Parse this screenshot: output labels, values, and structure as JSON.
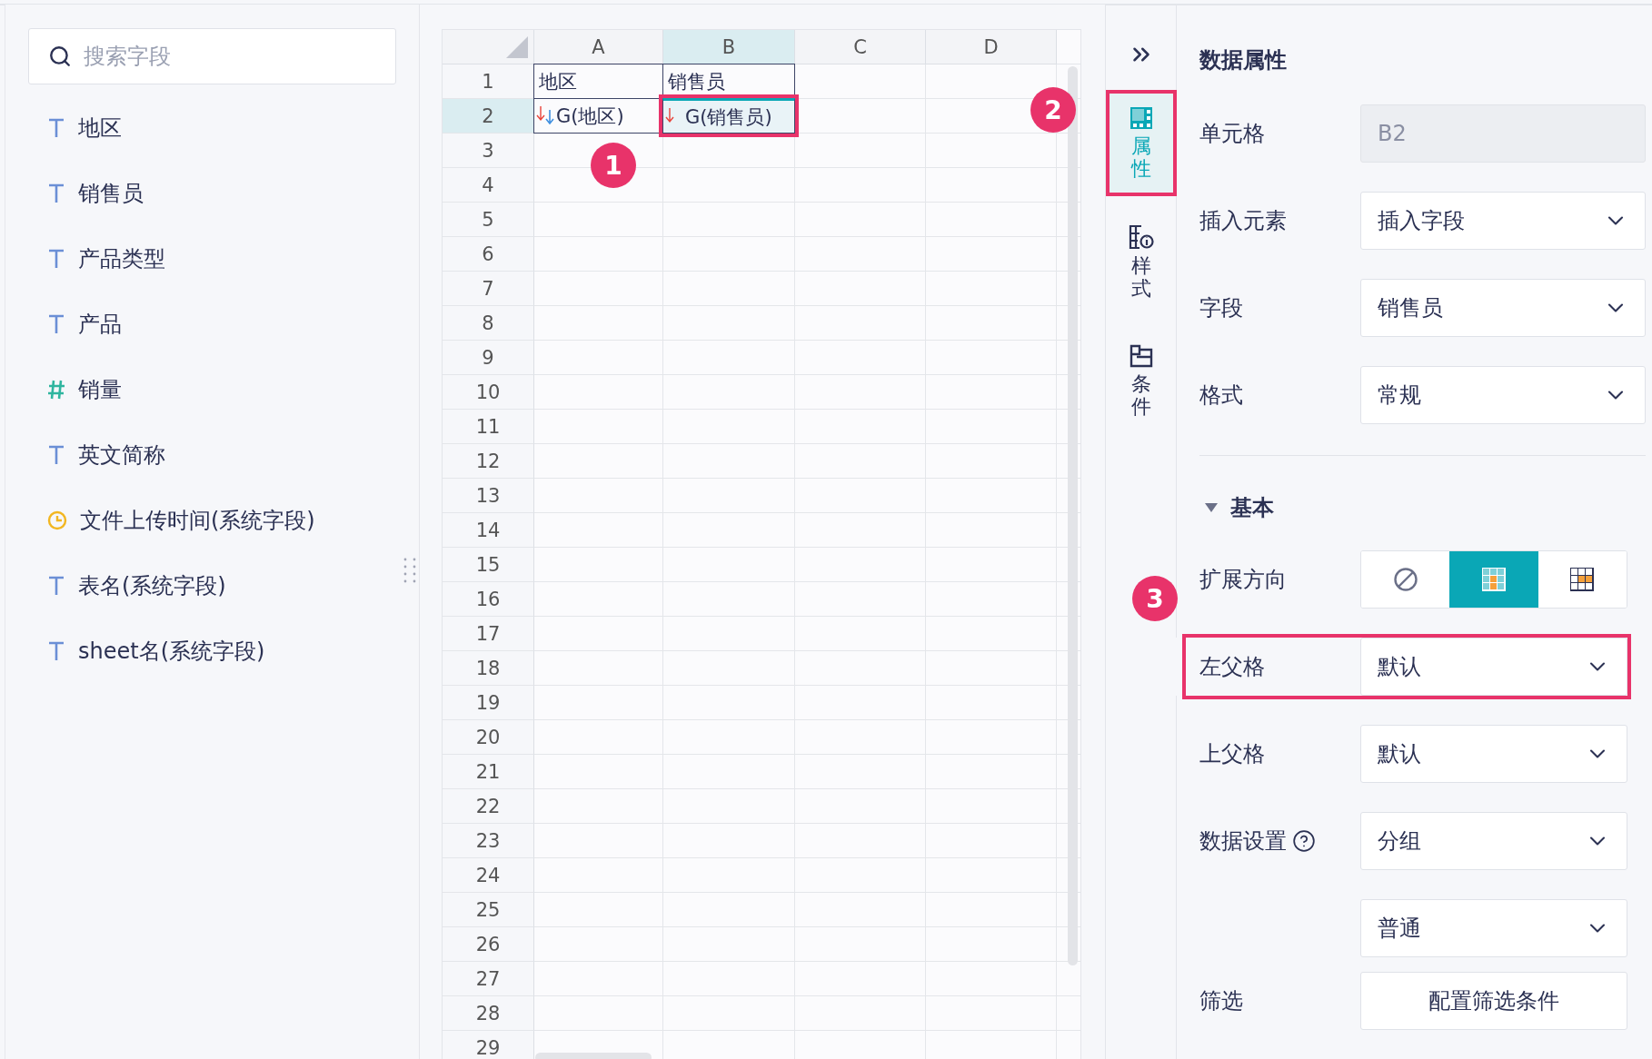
{
  "field_search": {
    "placeholder": "搜索字段"
  },
  "fields": [
    {
      "kind": "text",
      "name": "地区"
    },
    {
      "kind": "text",
      "name": "销售员"
    },
    {
      "kind": "text",
      "name": "产品类型"
    },
    {
      "kind": "text",
      "name": "产品"
    },
    {
      "kind": "number",
      "name": "销量"
    },
    {
      "kind": "text",
      "name": "英文简称"
    },
    {
      "kind": "time",
      "name": "文件上传时间(系统字段)"
    },
    {
      "kind": "text",
      "name": "表名(系统字段)"
    },
    {
      "kind": "text",
      "name": "sheet名(系统字段)"
    }
  ],
  "sheet": {
    "columns": [
      {
        "label": "A",
        "selected": false
      },
      {
        "label": "B",
        "selected": true
      },
      {
        "label": "C",
        "selected": false
      },
      {
        "label": "D",
        "selected": false
      }
    ],
    "rows": [
      {
        "label": "1",
        "selected": false,
        "cells": [
          {
            "text": "地区",
            "selected": false,
            "bordered": true
          },
          {
            "text": "销售员",
            "selected": false,
            "bordered": true
          }
        ]
      },
      {
        "label": "2",
        "selected": true,
        "cells": [
          {
            "text": "G(地区)",
            "selected": false,
            "bordered": true,
            "expand_mark": true,
            "parent_mark": true
          },
          {
            "text": "G(销售员)",
            "selected": true,
            "bordered": true,
            "expand_mark": true,
            "parent_mark": false,
            "annotated": true
          }
        ]
      },
      {
        "label": "3",
        "selected": false
      },
      {
        "label": "4",
        "selected": false
      },
      {
        "label": "5",
        "selected": false
      },
      {
        "label": "6",
        "selected": false
      },
      {
        "label": "7",
        "selected": false
      },
      {
        "label": "8",
        "selected": false
      },
      {
        "label": "9",
        "selected": false
      },
      {
        "label": "10",
        "selected": false
      },
      {
        "label": "11",
        "selected": false
      },
      {
        "label": "12",
        "selected": false
      },
      {
        "label": "13",
        "selected": false
      },
      {
        "label": "14",
        "selected": false
      },
      {
        "label": "15",
        "selected": false
      },
      {
        "label": "16",
        "selected": false
      },
      {
        "label": "17",
        "selected": false
      },
      {
        "label": "18",
        "selected": false
      },
      {
        "label": "19",
        "selected": false
      },
      {
        "label": "20",
        "selected": false
      },
      {
        "label": "21",
        "selected": false
      },
      {
        "label": "22",
        "selected": false
      },
      {
        "label": "23",
        "selected": false
      },
      {
        "label": "24",
        "selected": false
      },
      {
        "label": "25",
        "selected": false
      },
      {
        "label": "26",
        "selected": false
      },
      {
        "label": "27",
        "selected": false
      },
      {
        "label": "28",
        "selected": false
      },
      {
        "label": "29",
        "selected": false
      }
    ]
  },
  "side_tabs": [
    {
      "kind": "attributes",
      "label": "属性",
      "selected": true,
      "annotated": true
    },
    {
      "kind": "style",
      "label": "样式",
      "selected": false,
      "annotated": false
    },
    {
      "kind": "condition",
      "label": "条件",
      "selected": false,
      "annotated": false
    }
  ],
  "properties": {
    "title": "数据属性",
    "rows": [
      {
        "kind": "readonly",
        "label": "单元格",
        "value": "B2",
        "disabled": true
      },
      {
        "kind": "select",
        "label": "插入元素",
        "value": "插入字段"
      },
      {
        "kind": "select",
        "label": "字段",
        "value": "销售员"
      },
      {
        "kind": "select",
        "label": "格式",
        "value": "常规"
      }
    ],
    "section": {
      "title": "基本",
      "expanded": true,
      "rows": [
        {
          "kind": "segmented",
          "label": "扩展方向",
          "options": [
            {
              "kind": "none",
              "selected": false
            },
            {
              "kind": "vertical",
              "selected": true
            },
            {
              "kind": "horizontal",
              "selected": false
            }
          ]
        },
        {
          "kind": "select",
          "label": "左父格",
          "value": "默认",
          "annotated": true
        },
        {
          "kind": "select",
          "label": "上父格",
          "value": "默认"
        },
        {
          "kind": "select",
          "label": "数据设置",
          "value": "分组",
          "help": true
        },
        {
          "kind": "select",
          "value": "普通"
        },
        {
          "kind": "button",
          "label": "筛选",
          "value": "配置筛选条件"
        }
      ]
    }
  },
  "callouts": [
    {
      "label": "1"
    },
    {
      "label": "2"
    },
    {
      "label": "3"
    }
  ]
}
